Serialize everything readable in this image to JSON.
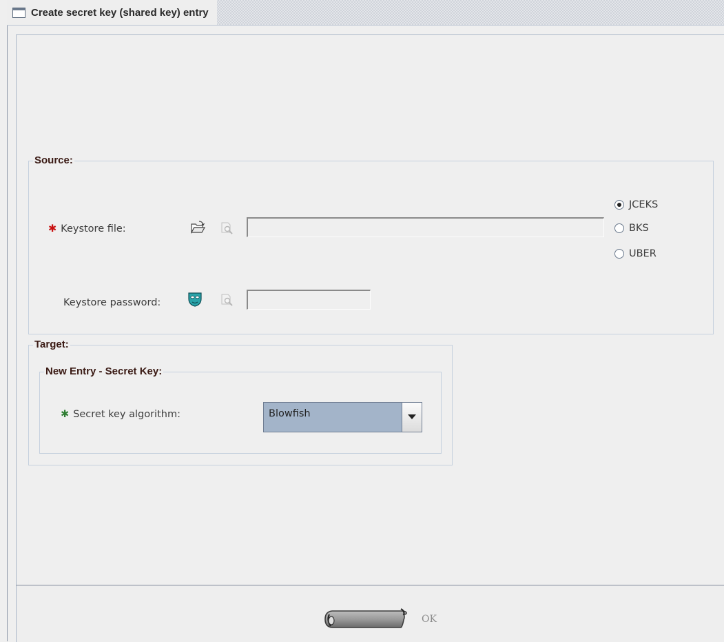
{
  "window": {
    "title": "Create secret key (shared key) entry"
  },
  "source": {
    "group_title": "Source:",
    "keystore_file_label": "Keystore file:",
    "keystore_file_value": "",
    "keystore_password_label": "Keystore password:",
    "keystore_password_value": "",
    "keystore_types": [
      {
        "label": "JCEKS",
        "selected": true
      },
      {
        "label": "BKS",
        "selected": false
      },
      {
        "label": "UBER",
        "selected": false
      }
    ]
  },
  "target": {
    "group_title": "Target:",
    "new_entry_title": "New Entry - Secret Key:",
    "algorithm_label": "Secret key algorithm:",
    "algorithm_value": "Blowfish"
  },
  "buttons": {
    "ok_label": "OK"
  },
  "icons": {
    "required": "asterisk-icon",
    "open_file": "folder-open-icon",
    "examine": "magnifier-icon",
    "password": "mask-icon",
    "dropdown": "chevron-down-icon",
    "ok": "scroll-icon"
  },
  "colors": {
    "required_red": "#c81010",
    "required_green": "#2e7d32",
    "combo_background": "#a3b4c9",
    "group_title": "#3a1a14"
  }
}
